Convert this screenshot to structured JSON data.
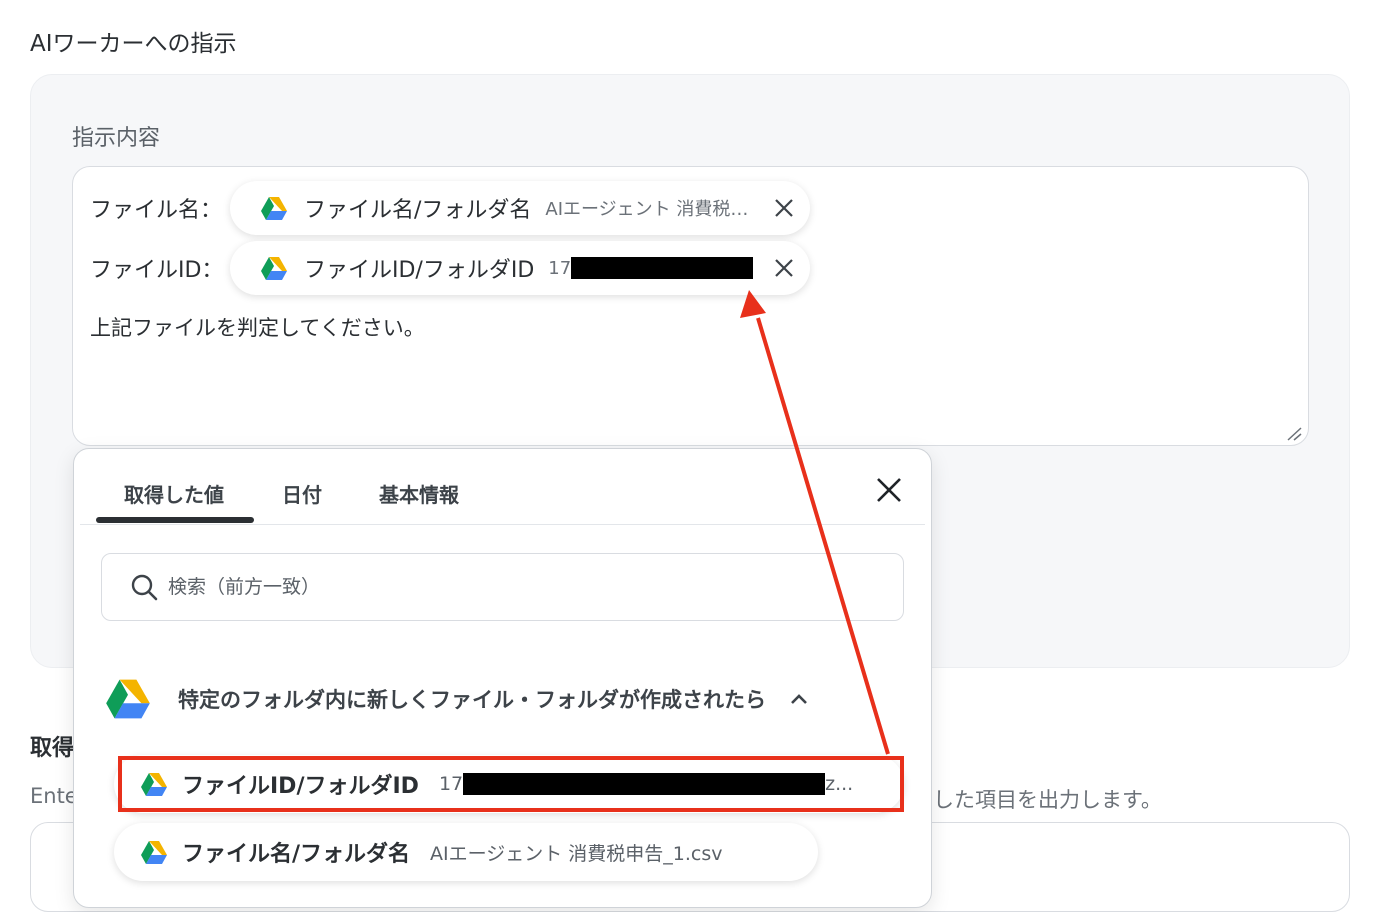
{
  "section": {
    "title": "AIワーカーへの指示"
  },
  "instruction": {
    "label": "指示内容",
    "rows": [
      {
        "label": "ファイル名：",
        "chip_name": "ファイル名/フォルダ名",
        "chip_value": "AIエージェント 消費税申告_1.csv"
      },
      {
        "label": "ファイルID：",
        "chip_name": "ファイルID/フォルダID",
        "chip_value": "17"
      }
    ],
    "body": "上記ファイルを判定してください。"
  },
  "popup": {
    "tabs": [
      "取得した値",
      "日付",
      "基本情報"
    ],
    "active_tab": 0,
    "search_placeholder": "検索（前方一致）",
    "group_label": "特定のフォルダ内に新しくファイル・フォルダが作成されたら",
    "items": [
      {
        "name": "ファイルID/フォルダID",
        "value_prefix": "17",
        "value_suffix": "z..."
      },
      {
        "name": "ファイル名/フォルダ名",
        "value": "AIエージェント 消費税申告_1.csv"
      }
    ]
  },
  "bottom": {
    "title_visible": "取得",
    "desc_left": "Ente",
    "desc_right": "した項目を出力します。"
  },
  "colors": {
    "highlight": "#e8301b",
    "arrow": "#e8301b",
    "drive_green": "#0f9d58",
    "drive_yellow": "#f4b400",
    "drive_blue": "#4285f4"
  }
}
